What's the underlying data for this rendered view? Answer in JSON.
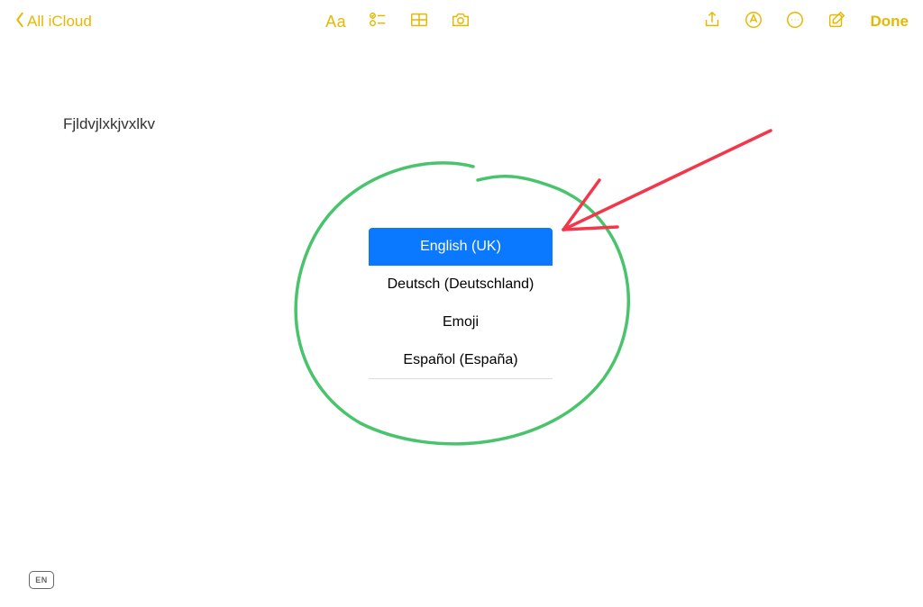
{
  "toolbar": {
    "back_label": "All iCloud",
    "aa_label": "Aa",
    "done_label": "Done"
  },
  "note": {
    "content": "Fjldvjlxkjvxlkv"
  },
  "language_menu": {
    "items": [
      {
        "label": "English (UK)",
        "selected": true
      },
      {
        "label": "Deutsch (Deutschland)",
        "selected": false
      },
      {
        "label": "Emoji",
        "selected": false
      },
      {
        "label": "Español (España)",
        "selected": false
      }
    ]
  },
  "keyboard_indicator": "EN",
  "colors": {
    "accent": "#E6B800",
    "selection": "#0A78FF",
    "annotation_circle": "#4AC46C",
    "annotation_arrow": "#F3374B"
  },
  "annotation": {
    "circle_description": "hand-drawn green circle around language menu",
    "arrow_description": "red arrow pointing to selected English (UK) item"
  }
}
